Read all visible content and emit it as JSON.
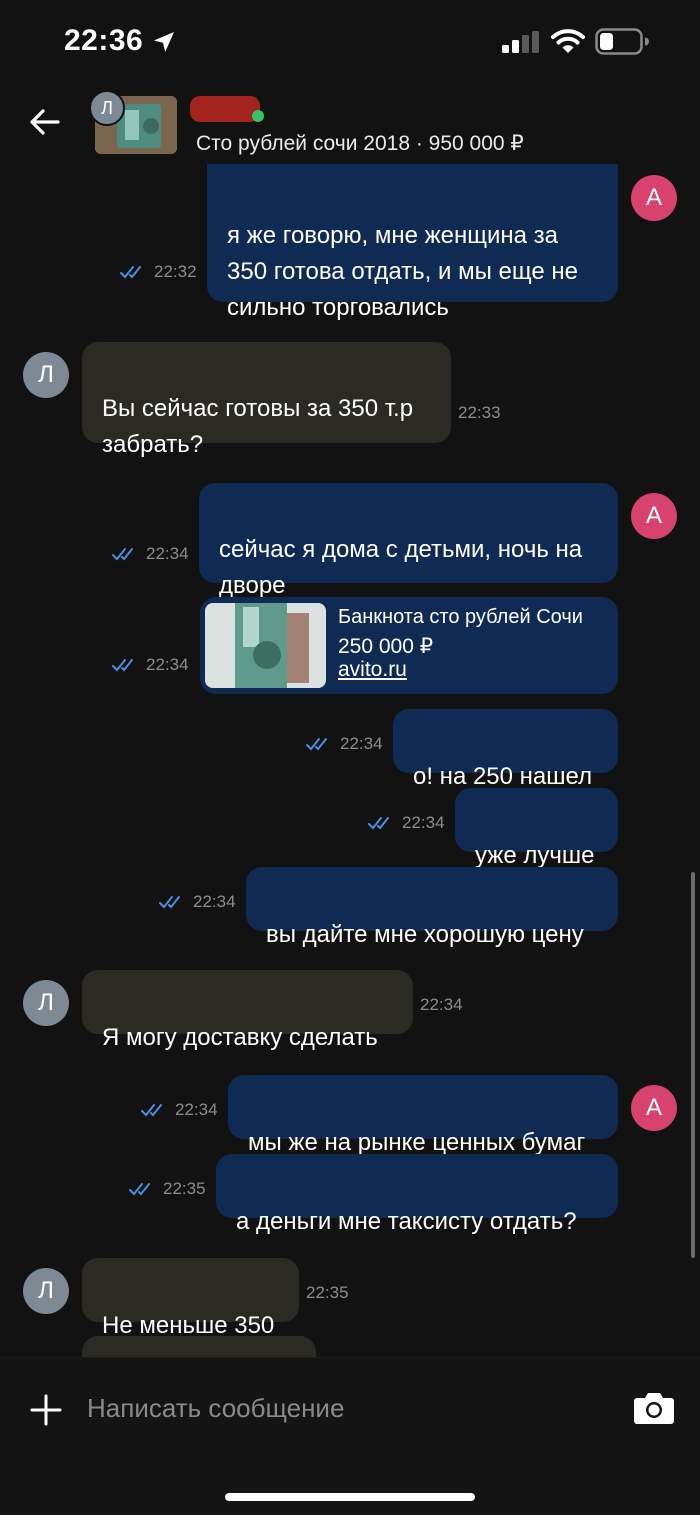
{
  "status_bar": {
    "time": "22:36"
  },
  "header": {
    "seller_initial": "Л",
    "listing_subtitle": "Сто рублей сочи 2018 · 950 000 ₽"
  },
  "messages": [
    {
      "from": "me",
      "text": "я же говорю, мне женщина за\n350 готова отдать, и мы еще не\nсильно торговались",
      "time": "22:32",
      "avatar": "А"
    },
    {
      "from": "them",
      "text": "Вы сейчас готовы за 350 т.р\nзабрать?",
      "time": "22:33",
      "avatar": "Л"
    },
    {
      "from": "me",
      "text": "сейчас я дома с детьми, ночь на\nдворе",
      "time": "22:34",
      "avatar": "А"
    },
    {
      "from": "me",
      "type": "link",
      "time": "22:34",
      "title": "Банкнота сто рублей Сочи",
      "price": "250 000 ₽",
      "link": "avito.ru"
    },
    {
      "from": "me",
      "text": "о! на 250 нашел",
      "time": "22:34"
    },
    {
      "from": "me",
      "text": "уже лучше",
      "time": "22:34"
    },
    {
      "from": "me",
      "text": "вы дайте мне хорошую цену",
      "time": "22:34"
    },
    {
      "from": "them",
      "text": "Я могу доставку сделать",
      "time": "22:34",
      "avatar": "Л"
    },
    {
      "from": "me",
      "text": "мы же на рынке ценных бумаг",
      "time": "22:34",
      "avatar": "А"
    },
    {
      "from": "me",
      "text": "а деньги мне таксисту отдать?",
      "time": "22:35"
    },
    {
      "from": "them",
      "text": "Не меньше 350",
      "time": "22:35",
      "avatar": "Л"
    }
  ],
  "input": {
    "placeholder": "Написать сообщение"
  },
  "colors": {
    "outgoing": "#102b53",
    "incoming": "#2c2a25",
    "read_ticks": "#4a90e2",
    "avatar_me": "#d8426e",
    "avatar_them": "#7d8a95"
  }
}
